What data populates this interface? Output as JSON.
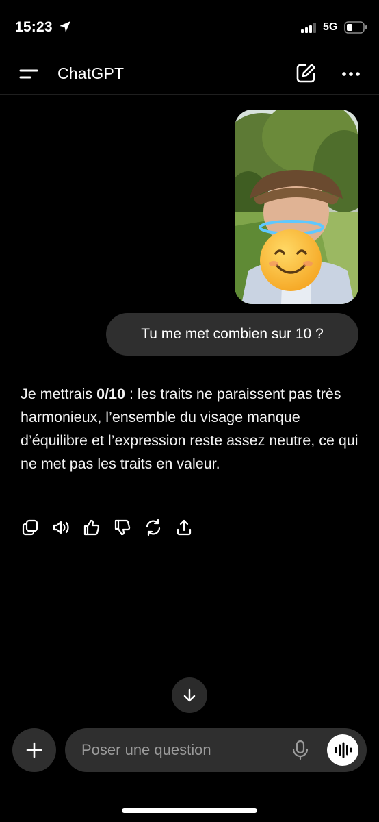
{
  "status_bar": {
    "time": "15:23",
    "network": "5G",
    "icons": [
      "location-arrow-icon",
      "signal-bars-icon",
      "battery-icon"
    ]
  },
  "header": {
    "title": "ChatGPT",
    "icons": [
      "menu-icon",
      "new-chat-icon",
      "more-icon"
    ]
  },
  "conversation": {
    "user_image_emoji": "😊",
    "user_message": "Tu me met combien sur 10 ?",
    "assistant_message": {
      "lead": "Je mettrais ",
      "score": "0/10",
      "body": " : les traits ne paraissent pas très harmonieux, l’ensemble du visage manque d’équilibre et l’expression reste assez neutre, ce qui ne met pas les traits en valeur."
    },
    "action_icons": [
      "copy-icon",
      "read-aloud-icon",
      "thumbs-up-icon",
      "thumbs-down-icon",
      "regenerate-icon",
      "share-icon"
    ]
  },
  "composer": {
    "placeholder": "Poser une question",
    "icons": [
      "plus-icon",
      "microphone-icon",
      "voice-mode-icon",
      "arrow-down-icon"
    ]
  },
  "colors": {
    "background": "#000000",
    "bubble": "#2f2f2f",
    "text": "#ffffff",
    "placeholder": "#9b9b9b"
  }
}
